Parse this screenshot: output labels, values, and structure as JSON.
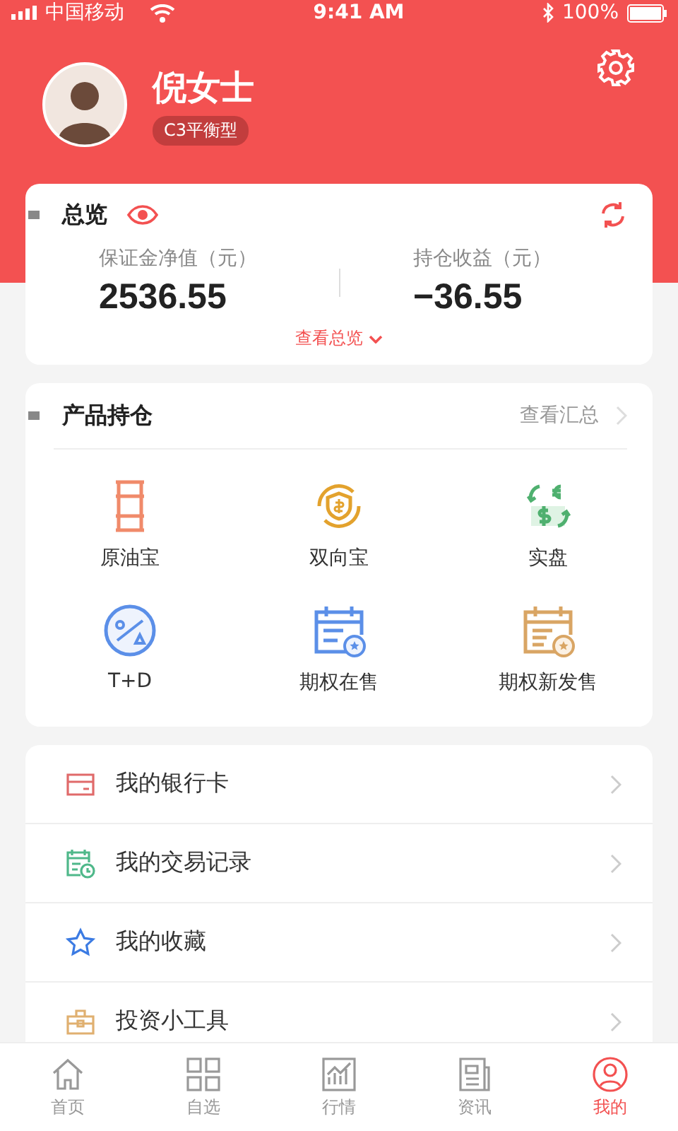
{
  "status_bar": {
    "carrier": "中国移动",
    "time": "9:41 AM",
    "battery": "100%"
  },
  "profile": {
    "name": "倪女士",
    "risk_badge": "C3平衡型"
  },
  "overview": {
    "title": "总览",
    "stats": [
      {
        "label": "保证金净值（元）",
        "value": "2536.55"
      },
      {
        "label": "持仓收益（元）",
        "value": "−36.55"
      }
    ],
    "link": "查看总览"
  },
  "holdings": {
    "title": "产品持仓",
    "link": "查看汇总",
    "items": [
      {
        "label": "原油宝"
      },
      {
        "label": "双向宝"
      },
      {
        "label": "实盘"
      },
      {
        "label": "T+D"
      },
      {
        "label": "期权在售"
      },
      {
        "label": "期权新发售"
      }
    ]
  },
  "menu": [
    {
      "label": "我的银行卡"
    },
    {
      "label": "我的交易记录"
    },
    {
      "label": "我的收藏"
    },
    {
      "label": "投资小工具"
    }
  ],
  "tabs": [
    {
      "label": "首页",
      "selected": false
    },
    {
      "label": "自选",
      "selected": false
    },
    {
      "label": "行情",
      "selected": false
    },
    {
      "label": "资讯",
      "selected": false
    },
    {
      "label": "我的",
      "selected": true
    }
  ]
}
